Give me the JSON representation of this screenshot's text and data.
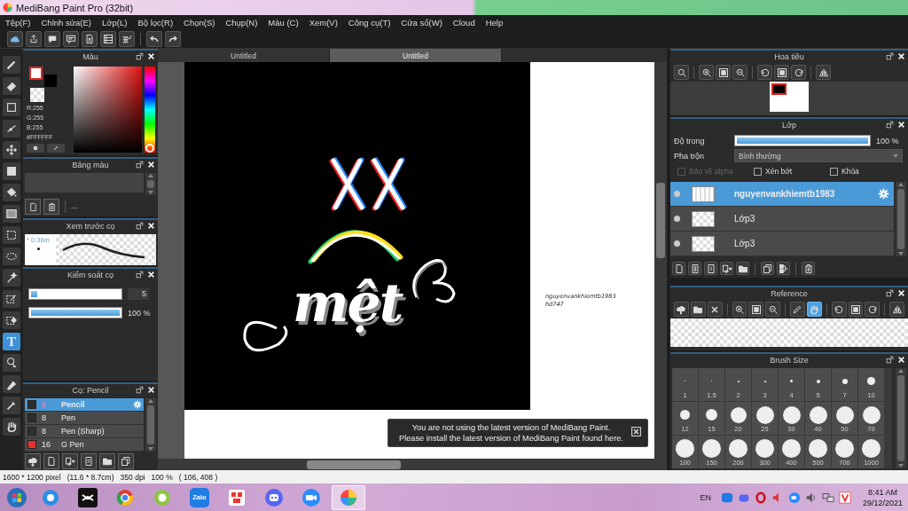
{
  "window": {
    "title": "MediBang Paint Pro (32bit)"
  },
  "menu": [
    "Tệp(F)",
    "Chỉnh sửa(E)",
    "Lớp(L)",
    "Bộ lọc(R)",
    "Chọn(S)",
    "Chụp(N)",
    "Màu (C)",
    "Xem(V)",
    "Công cụ(T)",
    "Cửa sổ(W)",
    "Cloud",
    "Help"
  ],
  "tools": [
    {
      "kind": "brush",
      "selected": false
    },
    {
      "kind": "eraser",
      "selected": false
    },
    {
      "kind": "rect",
      "selected": false
    },
    {
      "kind": "polyline",
      "selected": false
    },
    {
      "kind": "move",
      "selected": false
    },
    {
      "kind": "fillrect",
      "selected": false
    },
    {
      "kind": "bucket",
      "selected": false
    },
    {
      "kind": "gradient",
      "selected": false
    },
    {
      "kind": "selrect",
      "selected": false
    },
    {
      "kind": "lasso",
      "selected": false
    },
    {
      "kind": "wand",
      "selected": false
    },
    {
      "kind": "selpen",
      "selected": false
    },
    {
      "kind": "selerase",
      "selected": false
    },
    {
      "kind": "text",
      "glyph": "T",
      "selected": true
    },
    {
      "kind": "operation",
      "selected": false
    },
    {
      "kind": "divide",
      "selected": false
    },
    {
      "kind": "dropper",
      "selected": false
    },
    {
      "kind": "hand",
      "selected": false
    }
  ],
  "color_panel": {
    "title": "Màu",
    "r": "R:255",
    "g": "G:255",
    "b": "B:255",
    "hex": "#FFFFFF"
  },
  "palette_panel": {
    "title": "Bảng màu",
    "label": "---"
  },
  "brush_preview": {
    "title": "Xem trước cọ",
    "size": "* 0.36m"
  },
  "brush_control": {
    "title": "Kiểm soát cọ",
    "size": {
      "level": 0.07,
      "value": "5"
    },
    "opacity": {
      "level": 1,
      "reading": "100 %"
    }
  },
  "brush_list": {
    "title": "Cọ: Pencil",
    "items": [
      {
        "size": "5",
        "name": "Pencil",
        "color": "#2e2e2e",
        "selected": true
      },
      {
        "size": "8",
        "name": "Pen",
        "color": "#2e2e2e",
        "selected": false
      },
      {
        "size": "8",
        "name": "Pen (Sharp)",
        "color": "#2e2e2e",
        "selected": false
      },
      {
        "size": "16",
        "name": "G Pen",
        "color": "#e8302c",
        "selected": false
      }
    ]
  },
  "canvas": {
    "tabs": [
      {
        "label": "Untitled",
        "selected": false
      },
      {
        "label": "Untitled",
        "selected": true
      }
    ],
    "artwork_text": "mệt",
    "signature": [
      "nguyenvankhiemtb1983",
      "hd747"
    ]
  },
  "notice": {
    "text": "You are not using the latest version of MediBang Paint.\nPlease install the latest version of MediBang Paint found here."
  },
  "navigator": {
    "title": "Hoa tiêu"
  },
  "layers_panel": {
    "title": "Lớp",
    "opacity_label": "Độ trong",
    "opacity": {
      "level": 1,
      "reading": "100 %"
    },
    "blend_label": "Pha trộn",
    "blend": "Bình thường",
    "options": [
      {
        "label": "Bảo vệ alpha",
        "checked": false,
        "disabled": true
      },
      {
        "label": "Xén bớt",
        "checked": false,
        "disabled": false
      },
      {
        "label": "Khóa",
        "checked": false,
        "disabled": false
      }
    ],
    "layers": [
      {
        "name": "nguyenvankhiemtb1983",
        "selected": true
      },
      {
        "name": "Lớp3",
        "selected": false
      },
      {
        "name": "Lớp3",
        "selected": false
      }
    ]
  },
  "reference": {
    "title": "Reference",
    "tools": [
      {
        "kind": "upload",
        "selected": false
      },
      {
        "kind": "folder",
        "selected": false
      },
      {
        "kind": "close",
        "selected": false
      },
      {
        "kind": "zoomin",
        "selected": false
      },
      {
        "kind": "fit",
        "selected": false
      },
      {
        "kind": "zoomout",
        "selected": false
      },
      {
        "kind": "pen",
        "selected": false
      },
      {
        "kind": "hand",
        "selected": true
      },
      {
        "kind": "rotl",
        "selected": false
      },
      {
        "kind": "fit",
        "selected": false
      },
      {
        "kind": "rotr",
        "selected": false
      },
      {
        "kind": "flip",
        "selected": false
      }
    ]
  },
  "brush_size": {
    "title": "Brush Size",
    "sizes": [
      "1",
      "1.5",
      "2",
      "3",
      "4",
      "5",
      "7",
      "10",
      "12",
      "15",
      "20",
      "25",
      "30",
      "40",
      "50",
      "70",
      "100",
      "150",
      "200",
      "300",
      "400",
      "500",
      "700",
      "1000"
    ]
  },
  "status_bar": "1600 * 1200 pixel   (11.6 * 8.7cm)   350 dpi   100 %   ( 106, 408 )",
  "taskbar": {
    "apps": [
      {
        "kind": "browser",
        "active": false
      },
      {
        "kind": "capcut",
        "active": false
      },
      {
        "kind": "chrome",
        "active": false
      },
      {
        "kind": "coccoc",
        "active": false
      },
      {
        "kind": "zalo",
        "label": "Zalo",
        "active": false
      },
      {
        "kind": "redapp",
        "active": false
      },
      {
        "kind": "discord",
        "active": false
      },
      {
        "kind": "zoom",
        "active": false
      },
      {
        "kind": "medibang",
        "active": true
      }
    ],
    "language": "EN",
    "time": "8:41 AM",
    "date": "29/12/2021"
  }
}
